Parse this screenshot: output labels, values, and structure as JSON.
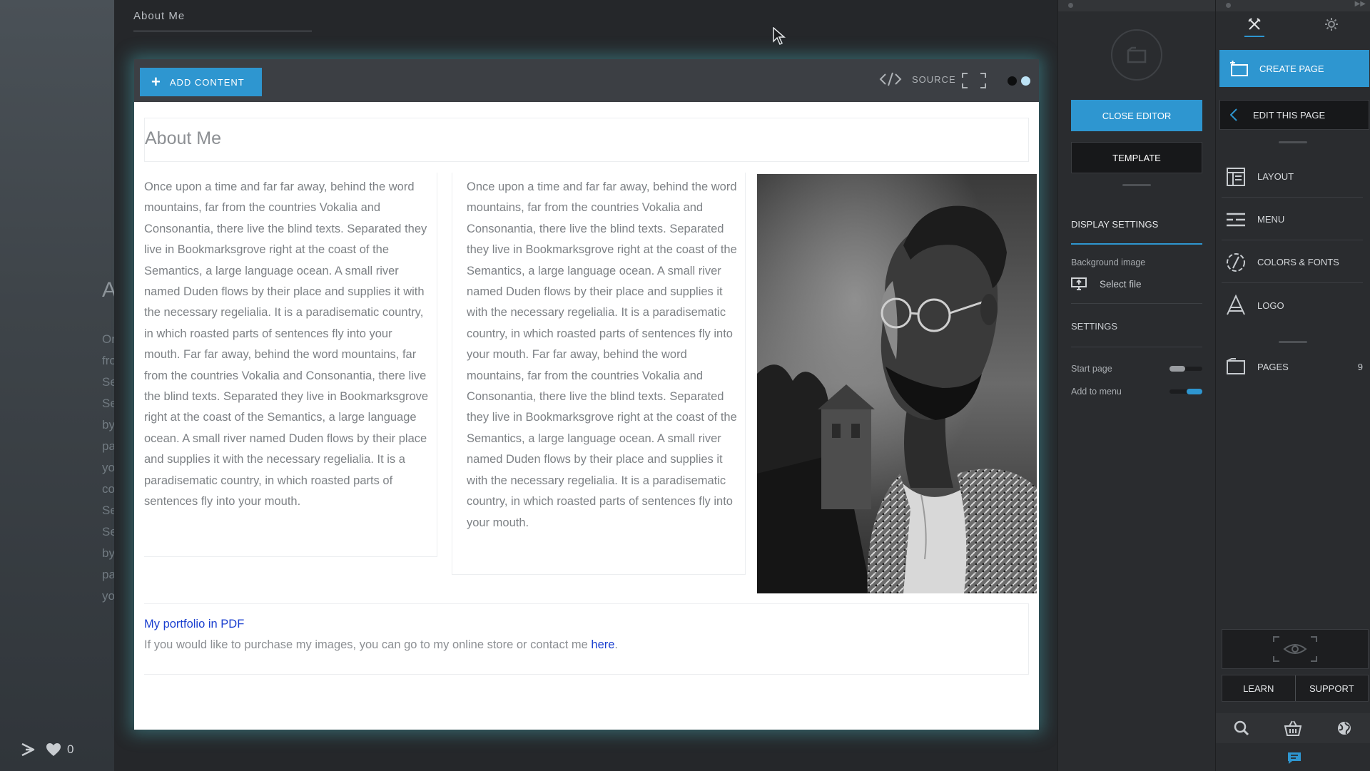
{
  "background": {
    "big_letter": "A",
    "ghost_lines": [
      "Or",
      "fro",
      "Se",
      "Se",
      "by",
      "pa",
      "yo",
      "co",
      "Se",
      "Se",
      "by",
      "pa",
      "yo"
    ],
    "likes_count": "0"
  },
  "editor": {
    "page_name": "About Me",
    "toolbar": {
      "add_content_label": "ADD CONTENT",
      "source_label": "SOURCE"
    },
    "content": {
      "title": "About Me",
      "column1_text": "Once upon a time and far far away, behind the word mountains, far from the countries Vokalia and Consonantia, there live the blind texts. Separated they live in Bookmarksgrove right at the coast of the Semantics, a large language ocean. A small river named Duden flows by their place and supplies it with the necessary regelialia. It is a paradisematic country, in which roasted parts of sentences fly into your mouth. Far far away, behind the word mountains, far from the countries Vokalia and Consonantia, there live the blind texts. Separated they live in Bookmarksgrove right at the coast of the Semantics, a large language ocean. A small river named Duden flows by their place and supplies it with the necessary regelialia.  It is a paradisematic country, in which roasted parts of sentences fly into your mouth.",
      "column2_text": "Once upon a time and far far away, behind the word mountains, far from the countries Vokalia and Consonantia, there live the blind texts. Separated they live in Bookmarksgrove right at the coast of the Semantics, a large language ocean. A small river named Duden flows by their place and supplies it with the necessary regelialia. It is a paradisematic country, in which roasted parts of sentences fly into your mouth. Far far away, behind the word mountains, far from the countries Vokalia and Consonantia, there live the blind texts. Separated they live in Bookmarksgrove right at the coast of the Semantics, a large language ocean. A small river named Duden flows by their place and supplies it with the necessary regelialia.  It is a paradisematic country, in which roasted parts of sentences fly into your mouth.",
      "portfolio_link": "My portfolio in PDF",
      "store_text": "If you would like to purchase my images, you can go to my online store or contact me ",
      "store_link": "here",
      "store_end": "."
    }
  },
  "settings_panel": {
    "close_editor_label": "CLOSE EDITOR",
    "template_label": "TEMPLATE",
    "display_settings_label": "DISPLAY SETTINGS",
    "background_image_label": "Background image",
    "select_file_label": "Select file",
    "settings_label": "SETTINGS",
    "start_page_label": "Start page",
    "start_page_on": false,
    "add_to_menu_label": "Add to menu",
    "add_to_menu_on": true
  },
  "nav_panel": {
    "create_page_label": "CREATE PAGE",
    "edit_page_label": "EDIT THIS PAGE",
    "items": [
      {
        "label": "LAYOUT",
        "icon": "layout-icon"
      },
      {
        "label": "MENU",
        "icon": "menu-icon"
      },
      {
        "label": "COLORS & FONTS",
        "icon": "colors-fonts-icon"
      },
      {
        "label": "LOGO",
        "icon": "logo-icon"
      }
    ],
    "pages_label": "PAGES",
    "pages_count": "9",
    "learn_label": "LEARN",
    "support_label": "SUPPORT"
  },
  "colors": {
    "accent": "#2e96d0",
    "link": "#1a3fcf",
    "glow": "#46aab4"
  }
}
